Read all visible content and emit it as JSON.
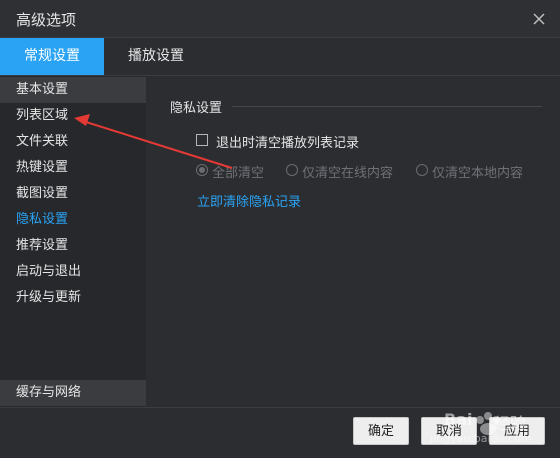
{
  "window": {
    "title": "高级选项"
  },
  "tabs": [
    {
      "label": "常规设置",
      "active": true
    },
    {
      "label": "播放设置",
      "active": false
    }
  ],
  "sidebar": {
    "items": [
      {
        "label": "基本设置"
      },
      {
        "label": "列表区域"
      },
      {
        "label": "文件关联"
      },
      {
        "label": "热键设置"
      },
      {
        "label": "截图设置"
      },
      {
        "label": "隐私设置"
      },
      {
        "label": "推荐设置"
      },
      {
        "label": "启动与退出"
      },
      {
        "label": "升级与更新"
      }
    ],
    "bottom_item": "缓存与网络"
  },
  "privacy": {
    "section_title": "隐私设置",
    "checkbox_label": "退出时清空播放列表记录",
    "radios": [
      {
        "label": "全部清空"
      },
      {
        "label": "仅清空在线内容"
      },
      {
        "label": "仅清空本地内容"
      }
    ],
    "clear_link": "立即清除隐私记录"
  },
  "footer": {
    "ok": "确定",
    "cancel": "取消",
    "apply": "应用"
  },
  "watermark": {
    "brand": "Bai",
    "cn": "经验",
    "url": "jingyan.baidu.com"
  },
  "colors": {
    "accent": "#2aa3f4",
    "background": "#2b2d31",
    "annotation_arrow": "#e53935"
  }
}
